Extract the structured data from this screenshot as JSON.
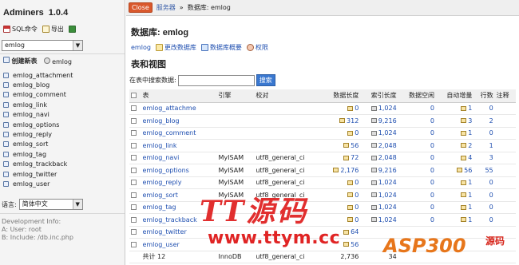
{
  "app": {
    "name": "Adminers",
    "version": "1.0.4"
  },
  "sidebar": {
    "sql_label": "SQL命令",
    "export_label": "导出",
    "db_select": "emlog",
    "create_table_label": "创建新表",
    "db_label": "emlog",
    "tables": [
      "emlog_attachment",
      "emlog_blog",
      "emlog_comment",
      "emlog_link",
      "emlog_navi",
      "emlog_options",
      "emlog_reply",
      "emlog_sort",
      "emlog_tag",
      "emlog_trackback",
      "emlog_twitter",
      "emlog_user"
    ],
    "lang_label": "语言:",
    "lang_value": "简体中文",
    "dev_info": [
      "Development Info:",
      "A: User: root",
      "B: Include: /db.inc.php"
    ]
  },
  "header": {
    "close_label": "Close",
    "crumb_server": "服务器",
    "crumb_sep": "»",
    "crumb_current": "数据库: emlog"
  },
  "main": {
    "title": "数据库: emlog",
    "actions": [
      "emlog",
      "更改数据库",
      "数据库概要",
      "权限"
    ],
    "subtitle": "表和视图",
    "search_label": "在表中搜索数据:",
    "search_button": "搜索",
    "columns": [
      "表",
      "引擎",
      "校对",
      "数据长度",
      "索引长度",
      "数据空闲",
      "自动增量",
      "行数",
      "注释"
    ],
    "rows": [
      {
        "name": "emlog_attachme",
        "engine": "",
        "collation": "",
        "data": "0",
        "index": "1,024",
        "free": "0",
        "auto": "1",
        "rows": "0"
      },
      {
        "name": "emlog_blog",
        "engine": "",
        "collation": "",
        "data": "312",
        "index": "9,216",
        "free": "0",
        "auto": "3",
        "rows": "2"
      },
      {
        "name": "emlog_comment",
        "engine": "",
        "collation": "",
        "data": "0",
        "index": "1,024",
        "free": "0",
        "auto": "1",
        "rows": "0"
      },
      {
        "name": "emlog_link",
        "engine": "",
        "collation": "",
        "data": "56",
        "index": "2,048",
        "free": "0",
        "auto": "2",
        "rows": "1"
      },
      {
        "name": "emlog_navi",
        "engine": "MyISAM",
        "collation": "utf8_general_ci",
        "data": "72",
        "index": "2,048",
        "free": "0",
        "auto": "4",
        "rows": "3"
      },
      {
        "name": "emlog_options",
        "engine": "MyISAM",
        "collation": "utf8_general_ci",
        "data": "2,176",
        "index": "9,216",
        "free": "0",
        "auto": "56",
        "rows": "55"
      },
      {
        "name": "emlog_reply",
        "engine": "MyISAM",
        "collation": "utf8_general_ci",
        "data": "0",
        "index": "1,024",
        "free": "0",
        "auto": "1",
        "rows": "0"
      },
      {
        "name": "emlog_sort",
        "engine": "MyISAM",
        "collation": "utf8_general_ci",
        "data": "0",
        "index": "1,024",
        "free": "0",
        "auto": "1",
        "rows": "0"
      },
      {
        "name": "emlog_tag",
        "engine": "",
        "collation": "",
        "data": "0",
        "index": "1,024",
        "free": "0",
        "auto": "1",
        "rows": "0"
      },
      {
        "name": "emlog_trackback",
        "engine": "",
        "collation": "",
        "data": "0",
        "index": "1,024",
        "free": "0",
        "auto": "1",
        "rows": "0"
      },
      {
        "name": "emlog_twitter",
        "engine": "",
        "collation": "",
        "data": "64",
        "index": "",
        "free": "",
        "auto": "",
        "rows": ""
      },
      {
        "name": "emlog_user",
        "engine": "",
        "collation": "",
        "data": "56",
        "index": "",
        "free": "",
        "auto": "",
        "rows": ""
      }
    ],
    "total": {
      "label": "共计 12",
      "engine": "InnoDB",
      "collation": "utf8_general_ci",
      "data": "2,736",
      "index": "34"
    }
  },
  "watermarks": [
    "TT源码",
    "www.ttym.cc",
    "ASP300",
    "源码"
  ]
}
